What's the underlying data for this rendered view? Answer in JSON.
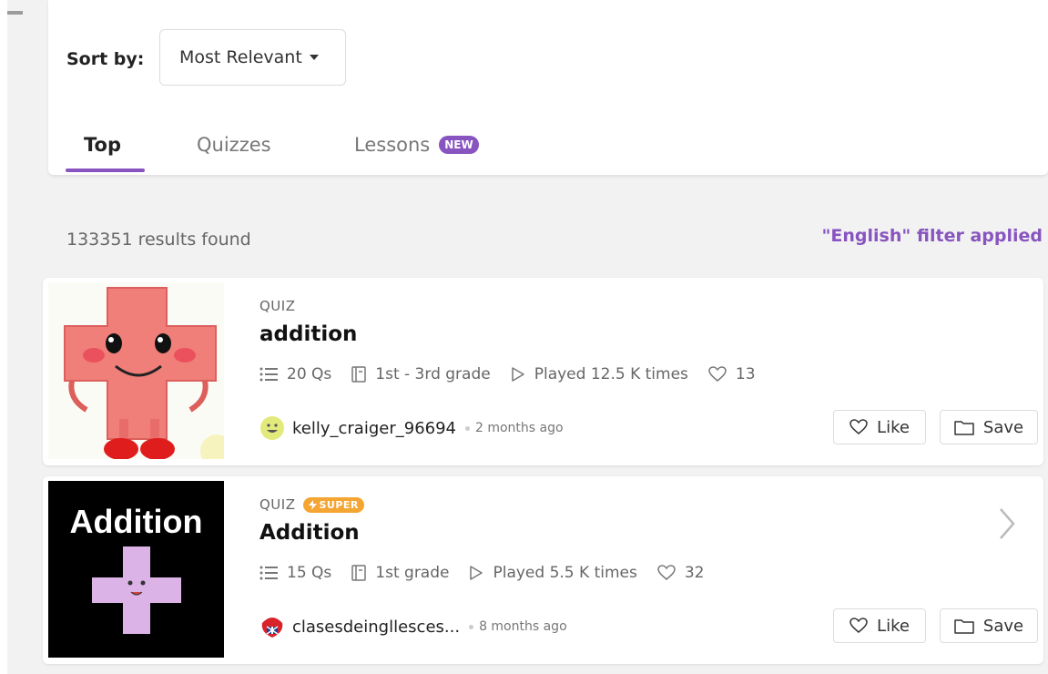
{
  "sort": {
    "label": "Sort by:",
    "value": "Most Relevant"
  },
  "tabs": [
    {
      "label": "Top",
      "active": true
    },
    {
      "label": "Quizzes",
      "active": false
    },
    {
      "label": "Lessons",
      "badge": "NEW",
      "active": false
    }
  ],
  "results": {
    "count_text": "133351 results found",
    "filter_text": "\"English\" filter applied"
  },
  "colors": {
    "accent": "#8854c0",
    "super": "#f4a532"
  },
  "cards": [
    {
      "type": "QUIZ",
      "title": "addition",
      "questions": "20 Qs",
      "grade": "1st - 3rd grade",
      "played": "Played 12.5 K times",
      "likes": "13",
      "author": "kelly_craiger_96694",
      "time_ago": "2 months ago",
      "like_label": "Like",
      "save_label": "Save",
      "thumbnail_icon": "pink-plus-character-image"
    },
    {
      "type": "QUIZ",
      "badge": "SUPER",
      "title": "Addition",
      "questions": "15 Qs",
      "grade": "1st grade",
      "played": "Played 5.5 K times",
      "likes": "32",
      "author": "clasesdeingllesces...",
      "time_ago": "8 months ago",
      "like_label": "Like",
      "save_label": "Save",
      "thumbnail_text": "Addition",
      "thumbnail_icon": "purple-plus-character-image"
    }
  ]
}
